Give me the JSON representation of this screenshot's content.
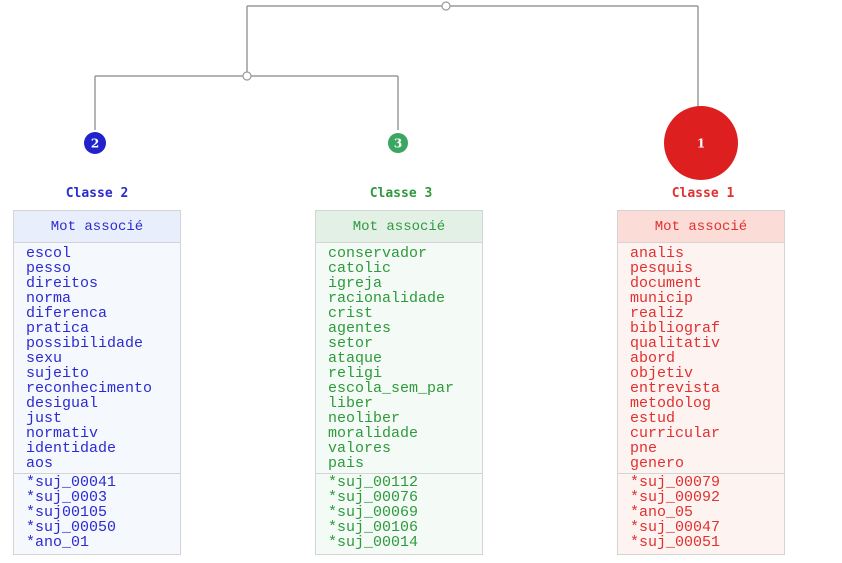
{
  "classes": [
    {
      "id": "2",
      "title": "Classe 2",
      "color": "#2b2bd0",
      "node_color": "#2222cc",
      "header_bg": "#e8eefb",
      "body_bg": "#f5f8fd",
      "header_label": "Mot associé",
      "words": [
        "escol",
        "pesso",
        "direitos",
        "norma",
        "diferenca",
        "pratica",
        "possibilidade",
        "sexu",
        "sujeito",
        "reconhecimento",
        "desigual",
        "just",
        "normativ",
        "identidade",
        "aos"
      ],
      "variables": [
        "*suj_00041",
        "*suj_0003",
        "*suj00105",
        "*suj_00050",
        "*ano_01"
      ]
    },
    {
      "id": "3",
      "title": "Classe 3",
      "color": "#2e9a3c",
      "node_color": "#3aa660",
      "header_bg": "#e3f0e6",
      "body_bg": "#f4faf5",
      "header_label": "Mot associé",
      "words": [
        "conservador",
        "catolic",
        "igreja",
        "racionalidade",
        "crist",
        "agentes",
        "setor",
        "ataque",
        "religi",
        "escola_sem_par",
        "liber",
        "neoliber",
        "moralidade",
        "valores",
        "pais"
      ],
      "variables": [
        "*suj_00112",
        "*suj_00076",
        "*suj_00069",
        "*suj_00106",
        "*suj_00014"
      ]
    },
    {
      "id": "1",
      "title": "Classe 1",
      "color": "#e03030",
      "node_color": "#dd1f1f",
      "header_bg": "#fbdcd6",
      "body_bg": "#fdf4f1",
      "header_label": "Mot associé",
      "words": [
        "analis",
        "pesquis",
        "document",
        "municip",
        "realiz",
        "bibliograf",
        "qualitativ",
        "abord",
        "objetiv",
        "entrevista",
        "metodolog",
        "estud",
        "curricular",
        "pne",
        "genero"
      ],
      "variables": [
        "*suj_00079",
        "*suj_00092",
        "*ano_05",
        "*suj_00047",
        "*suj_00051"
      ]
    }
  ]
}
